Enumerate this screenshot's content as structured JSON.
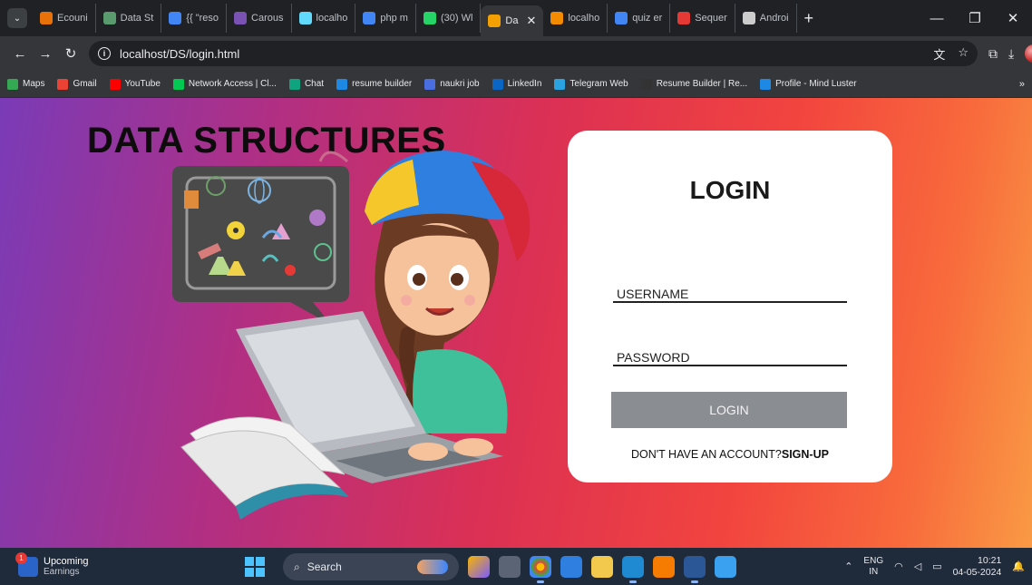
{
  "browser": {
    "tabs": [
      {
        "label": "Ecouni",
        "color": "#e8710a"
      },
      {
        "label": "Data St",
        "color": "#5a9b6e"
      },
      {
        "label": "{{ \"reso",
        "color": "#4285f4"
      },
      {
        "label": "Carous",
        "color": "#7952b3"
      },
      {
        "label": "localho",
        "color": "#61dafb"
      },
      {
        "label": "php m",
        "color": "#4285f4"
      },
      {
        "label": "(30) Wl",
        "color": "#25d366"
      },
      {
        "label": "Da",
        "color": "#f4a000",
        "active": true
      },
      {
        "label": "localho",
        "color": "#f28b00"
      },
      {
        "label": "quiz er",
        "color": "#4285f4"
      },
      {
        "label": "Sequer",
        "color": "#e53935"
      },
      {
        "label": "Androi",
        "color": "#cccccc"
      }
    ],
    "new_tab": "+",
    "url": "localhost/DS/login.html",
    "bookmarks": [
      {
        "label": "Maps",
        "color": "#34a853"
      },
      {
        "label": "Gmail",
        "color": "#ea4335"
      },
      {
        "label": "YouTube",
        "color": "#ff0000"
      },
      {
        "label": "Network Access | Cl...",
        "color": "#00c853"
      },
      {
        "label": "Chat",
        "color": "#10a37f"
      },
      {
        "label": "resume builder",
        "color": "#1e88e5"
      },
      {
        "label": "naukri job",
        "color": "#4a6ee0"
      },
      {
        "label": "LinkedIn",
        "color": "#0a66c2"
      },
      {
        "label": "Telegram Web",
        "color": "#2aa3e0"
      },
      {
        "label": "Resume Builder | Re...",
        "color": "#333333"
      },
      {
        "label": "Profile - Mind Luster",
        "color": "#1e88e5"
      }
    ],
    "bookmarks_more": "»"
  },
  "page": {
    "site_title": "DATA STRUCTURES",
    "login": {
      "title": "LOGIN",
      "username_label": "USERNAME",
      "password_label": "PASSWORD",
      "button_label": "LOGIN",
      "signup_prompt": "DON'T HAVE AN ACCOUNT?",
      "signup_link": "SIGN-UP"
    }
  },
  "taskbar": {
    "weather_title": "Upcoming",
    "weather_sub": "Earnings",
    "weather_badge": "1",
    "search_placeholder": "Search",
    "lang_top": "ENG",
    "lang_bottom": "IN",
    "time": "10:21",
    "date": "04-05-2024"
  },
  "colors": {
    "login_button": "#8a8d92",
    "card": "#ffffff",
    "bg_left": "#7a3bb7",
    "bg_right": "#f99a44"
  }
}
